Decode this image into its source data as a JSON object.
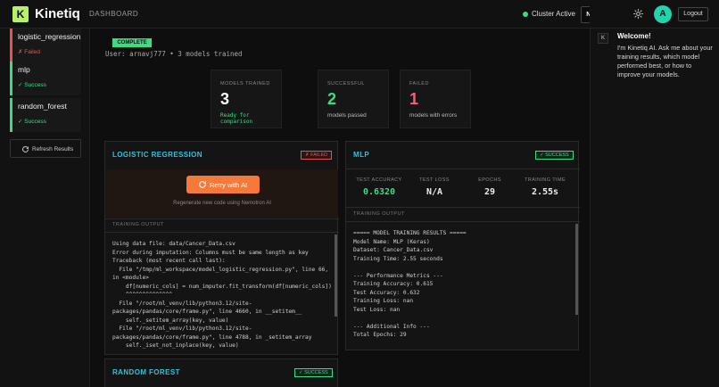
{
  "header": {
    "logo_letter": "K",
    "brand": "Kinetiq",
    "breadcrumb": "DASHBOARD",
    "cluster_status": "Cluster Active",
    "new_run_label": "NEW RUN",
    "avatar_letter": "A",
    "logout_label": "Logout"
  },
  "sidebar": {
    "items": [
      {
        "name": "logistic_regression",
        "status": "✗ Failed"
      },
      {
        "name": "mlp",
        "status": "✓ Success"
      },
      {
        "name": "random_forest",
        "status": "✓ Success"
      }
    ],
    "refresh_label": "Refresh Results"
  },
  "summary": {
    "badge": "COMPLETE",
    "user_line": "User: arnavj777 • 3 models trained",
    "stats": [
      {
        "label": "MODELS TRAINED",
        "value": "3",
        "sub": "Ready for comparison"
      },
      {
        "label": "SUCCESSFUL",
        "value": "2",
        "sub": "models passed"
      },
      {
        "label": "FAILED",
        "value": "1",
        "sub": "models with errors"
      }
    ]
  },
  "cards": {
    "logistic": {
      "title": "LOGISTIC REGRESSION",
      "badge": "✗ FAILED",
      "retry_label": "Retry with AI",
      "retry_sub": "Regenerate new code using Nemotron AI",
      "output_label": "TRAINING OUTPUT",
      "log": "Using data file: data/Cancer_Data.csv\nError during imputation: Columns must be same length as key\nTraceback (most recent call last):\n  File \"/tmp/ml_workspace/model_logistic_regression.py\", line 66,\nin <module>\n    df[numeric_cols] = num_imputer.fit_transform(df[numeric_cols])\n    ^^^^^^^^^^^^^^\n  File \"/root/ml_venv/lib/python3.12/site-\npackages/pandas/core/frame.py\", line 4660, in __setitem__\n    self._setitem_array(key, value)\n  File \"/root/ml_venv/lib/python3.12/site-\npackages/pandas/core/frame.py\", line 4788, in _setitem_array\n    self._iset_not_inplace(key, value)"
    },
    "mlp": {
      "title": "MLP",
      "badge": "✓ SUCCESS",
      "metrics": [
        {
          "label": "TEST ACCURACY",
          "value": "0.6320"
        },
        {
          "label": "TEST LOSS",
          "value": "N/A"
        },
        {
          "label": "EPOCHS",
          "value": "29"
        },
        {
          "label": "TRAINING TIME",
          "value": "2.55s"
        }
      ],
      "output_label": "TRAINING OUTPUT",
      "log": "===== MODEL TRAINING RESULTS =====\nModel Name: MLP (Keras)\nDataset: Cancer_Data.csv\nTraining Time: 2.55 seconds\n\n--- Performance Metrics ---\nTraining Accuracy: 0.615\nTest Accuracy: 0.632\nTraining Loss: nan\nTest Loss: nan\n\n--- Additional Info ---\nTotal Epochs: 29"
    },
    "random_forest": {
      "title": "RANDOM FOREST",
      "badge": "✓ SUCCESS"
    }
  },
  "chat": {
    "k_letter": "K",
    "title": "Welcome!",
    "message": "I'm Kinetiq AI. Ask me about your training results, which model performed best, or how to improve your models."
  },
  "colors": {
    "accent": "#b8f06b",
    "success": "#3ddc84",
    "error": "#e05555",
    "title": "#2bc4dd",
    "retry": "#f47a3c"
  }
}
